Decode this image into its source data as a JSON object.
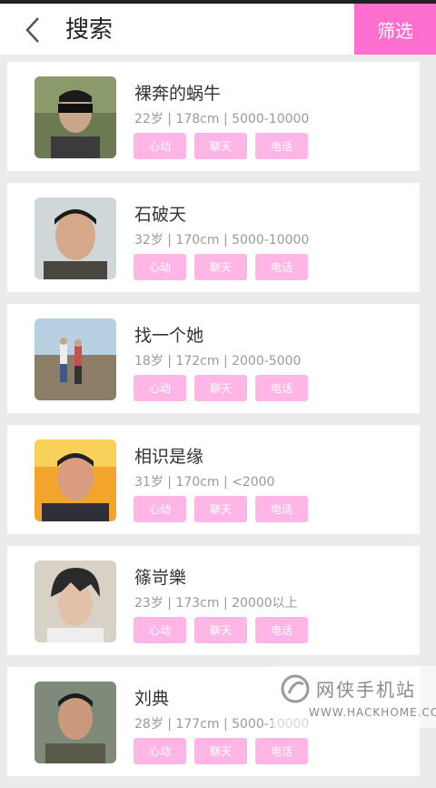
{
  "header": {
    "title": "搜索",
    "filter_label": "筛选"
  },
  "colors": {
    "accent": "#ff6fcf",
    "button": "#ffb5e6"
  },
  "actions": {
    "like": "心动",
    "chat": "聊天",
    "phone": "电话"
  },
  "profiles": [
    {
      "name": "裸奔的蜗牛",
      "info": "22岁 | 178cm | 5000-10000"
    },
    {
      "name": "石破天",
      "info": "32岁 | 170cm | 5000-10000"
    },
    {
      "name": "找一个她",
      "info": "18岁 | 172cm | 2000-5000"
    },
    {
      "name": "相识是缘",
      "info": "31岁 | 170cm | <2000"
    },
    {
      "name": "篠岢樂",
      "info": "23岁 | 173cm | 20000以上"
    },
    {
      "name": "刘典",
      "info": "28岁 | 177cm | 5000-10000"
    }
  ],
  "watermark": {
    "name": "网侠手机站",
    "url": "WWW.HACKHOME.COM"
  }
}
